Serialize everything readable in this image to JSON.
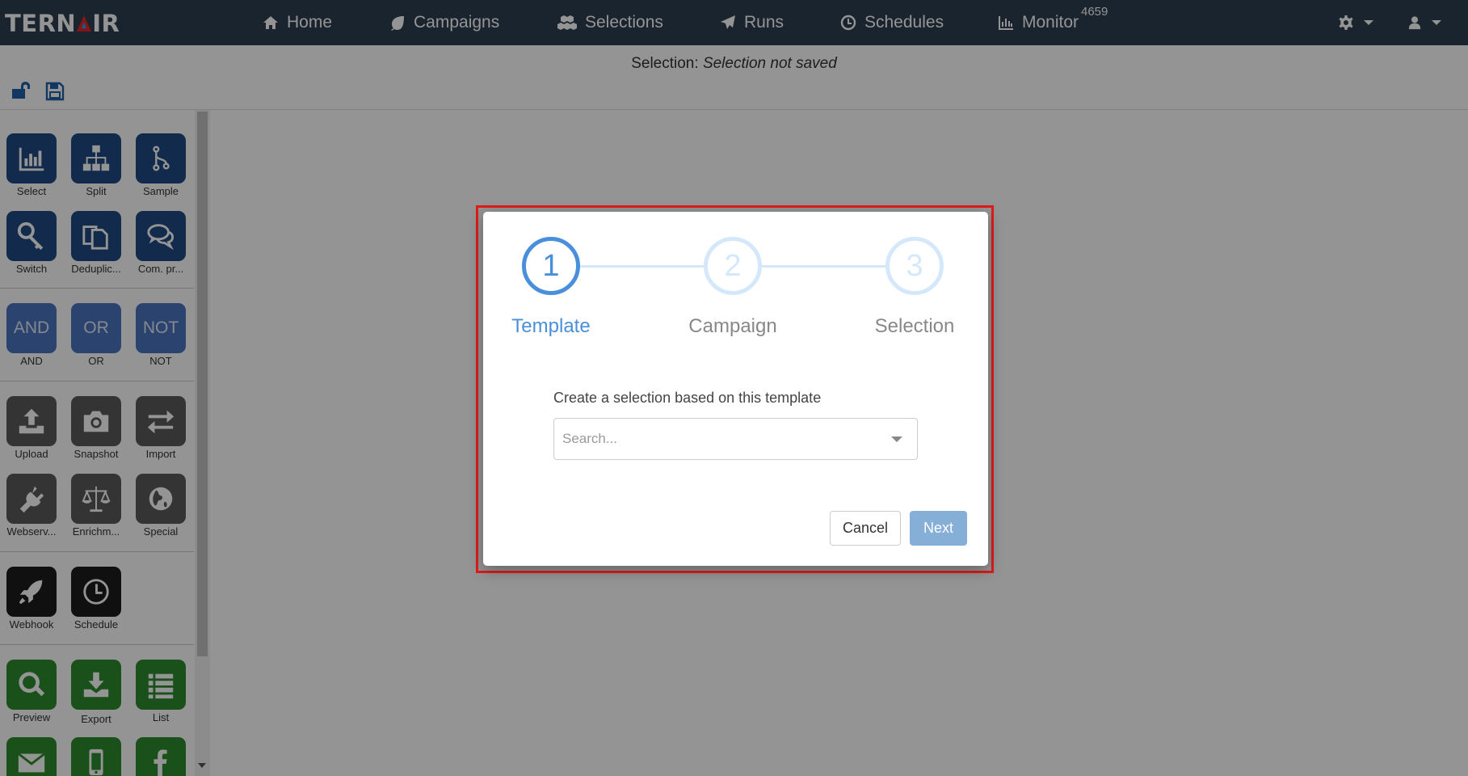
{
  "app": {
    "logo": "TERNAIR",
    "logo_left": "TERN",
    "logo_right": "IR"
  },
  "nav": {
    "items": [
      {
        "label": "Home",
        "icon": "home-icon"
      },
      {
        "label": "Campaigns",
        "icon": "leaf-icon"
      },
      {
        "label": "Selections",
        "icon": "cubes-icon"
      },
      {
        "label": "Runs",
        "icon": "paper-plane-icon"
      },
      {
        "label": "Schedules",
        "icon": "clock-icon"
      },
      {
        "label": "Monitor",
        "icon": "bar-chart-icon"
      }
    ],
    "monitor_badge": "4659",
    "settings_icon": "gear-icon",
    "user_icon": "user-icon"
  },
  "subheader": {
    "selection_prefix": "Selection:",
    "selection_name": "Selection not saved",
    "tools": [
      "unlock-icon",
      "save-icon"
    ]
  },
  "colors": {
    "navbar": "#2d3e50",
    "tile_blue": "#1f4a84",
    "tile_logic": "#4a76c0",
    "tile_gray": "#5a5a5a",
    "tile_dark": "#1d1d1d",
    "tile_green": "#2e8b2e",
    "accent": "#4a8fdc",
    "highlight": "#e01b1b"
  },
  "sidebar": {
    "tiles": [
      {
        "label": "Select",
        "icon": "bar-chart-icon"
      },
      {
        "label": "Split",
        "icon": "sitemap-icon"
      },
      {
        "label": "Sample",
        "icon": "branch-icon"
      },
      {
        "label": "Switch",
        "icon": "key-icon"
      },
      {
        "label": "Deduplic...",
        "icon": "copy-icon"
      },
      {
        "label": "Com. pr...",
        "icon": "comments-icon"
      },
      {
        "label": "AND",
        "text": "AND"
      },
      {
        "label": "OR",
        "text": "OR"
      },
      {
        "label": "NOT",
        "text": "NOT"
      },
      {
        "label": "Upload",
        "icon": "upload-icon"
      },
      {
        "label": "Snapshot",
        "icon": "camera-icon"
      },
      {
        "label": "Import",
        "icon": "exchange-icon"
      },
      {
        "label": "Webserv...",
        "icon": "plug-icon"
      },
      {
        "label": "Enrichm...",
        "icon": "balance-icon"
      },
      {
        "label": "Special",
        "icon": "globe-icon"
      },
      {
        "label": "Webhook",
        "icon": "rocket-icon"
      },
      {
        "label": "Schedule",
        "icon": "clock-icon"
      },
      {
        "label": "Preview",
        "icon": "search-icon"
      },
      {
        "label": "Export",
        "icon": "download-icon"
      },
      {
        "label": "List",
        "icon": "list-icon"
      },
      {
        "label": "",
        "icon": "envelope-icon"
      },
      {
        "label": "",
        "icon": "mobile-icon"
      },
      {
        "label": "",
        "icon": "facebook-icon"
      }
    ]
  },
  "modal": {
    "steps": [
      {
        "number": "1",
        "label": "Template"
      },
      {
        "number": "2",
        "label": "Campaign"
      },
      {
        "number": "3",
        "label": "Selection"
      }
    ],
    "active_step": 1,
    "field_label": "Create a selection based on this template",
    "search_placeholder": "Search...",
    "cancel_label": "Cancel",
    "next_label": "Next"
  }
}
